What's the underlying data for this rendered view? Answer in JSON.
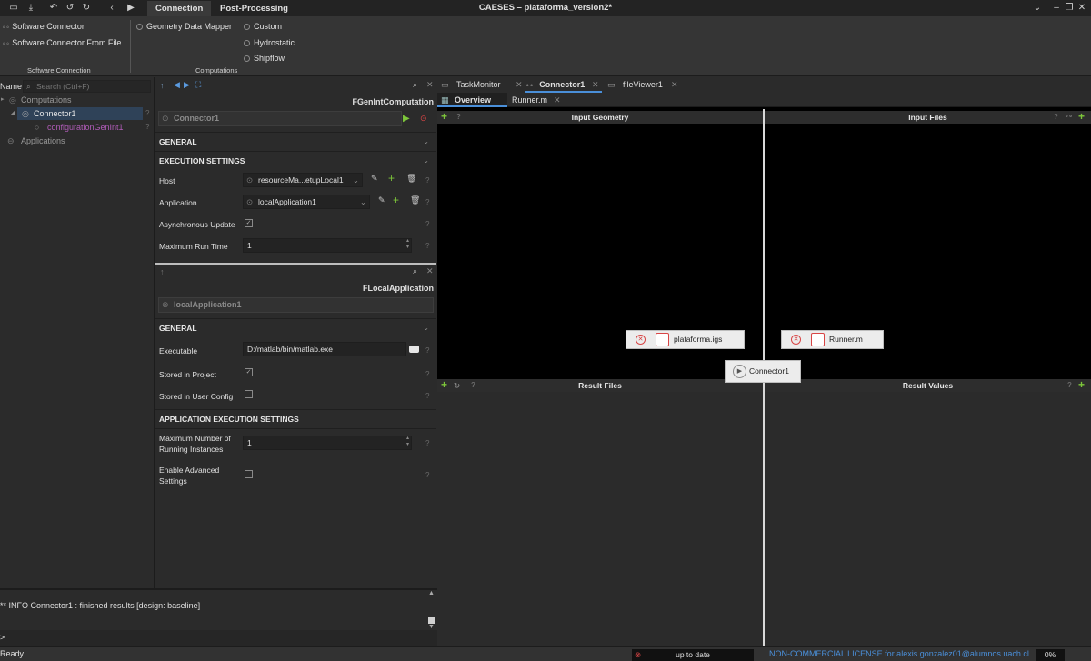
{
  "window": {
    "title": "CAESES – plataforma_version2*"
  },
  "ribbon": {
    "tabs": [
      "Connection",
      "Post-Processing"
    ],
    "groups": [
      {
        "label": "Software Connection",
        "items": [
          "Software Connector",
          "Software Connector From File"
        ]
      },
      {
        "label": "Computations",
        "items": [
          "Geometry Data Mapper",
          "Custom",
          "Hydrostatic",
          "Shipflow"
        ]
      }
    ]
  },
  "tree": {
    "header": "Name",
    "search_placeholder": "Search (Ctrl+F)",
    "items": [
      {
        "label": "Computations",
        "help": ""
      },
      {
        "label": "Connector1",
        "help": "?"
      },
      {
        "label": "configurationGenInt1",
        "help": "?"
      },
      {
        "label": "Applications",
        "help": ""
      }
    ]
  },
  "props_top": {
    "class_name": "FGenIntComputation",
    "object_name": "Connector1",
    "sections": {
      "general": "GENERAL",
      "exec": "EXECUTION SETTINGS"
    },
    "fields": {
      "host_label": "Host",
      "host_value": "resourceMa...etupLocal1",
      "app_label": "Application",
      "app_value": "localApplication1",
      "async_label": "Asynchronous Update",
      "maxrun_label": "Maximum Run Time",
      "maxrun_value": "1"
    }
  },
  "props_bottom": {
    "class_name": "FLocalApplication",
    "object_name": "localApplication1",
    "sections": {
      "general": "GENERAL",
      "app_exec": "APPLICATION EXECUTION SETTINGS"
    },
    "fields": {
      "exe_label": "Executable",
      "exe_value": "D:/matlab/bin/matlab.exe",
      "stored_project_label": "Stored in Project",
      "stored_user_label": "Stored in User Config",
      "maxinst_label_1": "Maximum Number of",
      "maxinst_label_2": "Running Instances",
      "maxinst_value": "1",
      "adv_label_1": "Enable Advanced",
      "adv_label_2": "Settings"
    }
  },
  "editor": {
    "doc_tabs": [
      "TaskMonitor",
      "Connector1",
      "fileViewer1"
    ],
    "sub_tabs": [
      "Overview",
      "Runner.m"
    ],
    "panes": {
      "input_geometry": "Input Geometry",
      "input_files": "Input Files",
      "result_files": "Result Files",
      "result_values": "Result Values"
    },
    "geometry_file": "plataforma.igs",
    "input_file": "Runner.m",
    "connector_node": "Connector1"
  },
  "console": {
    "message": "** INFO Connector1 : finished results [design: baseline]",
    "prompt": ">"
  },
  "status": {
    "left": "Ready",
    "state": "up to date",
    "license": "NON-COMMERCIAL LICENSE for alexis.gonzalez01@alumnos.uach.cl",
    "progress": "0%"
  }
}
